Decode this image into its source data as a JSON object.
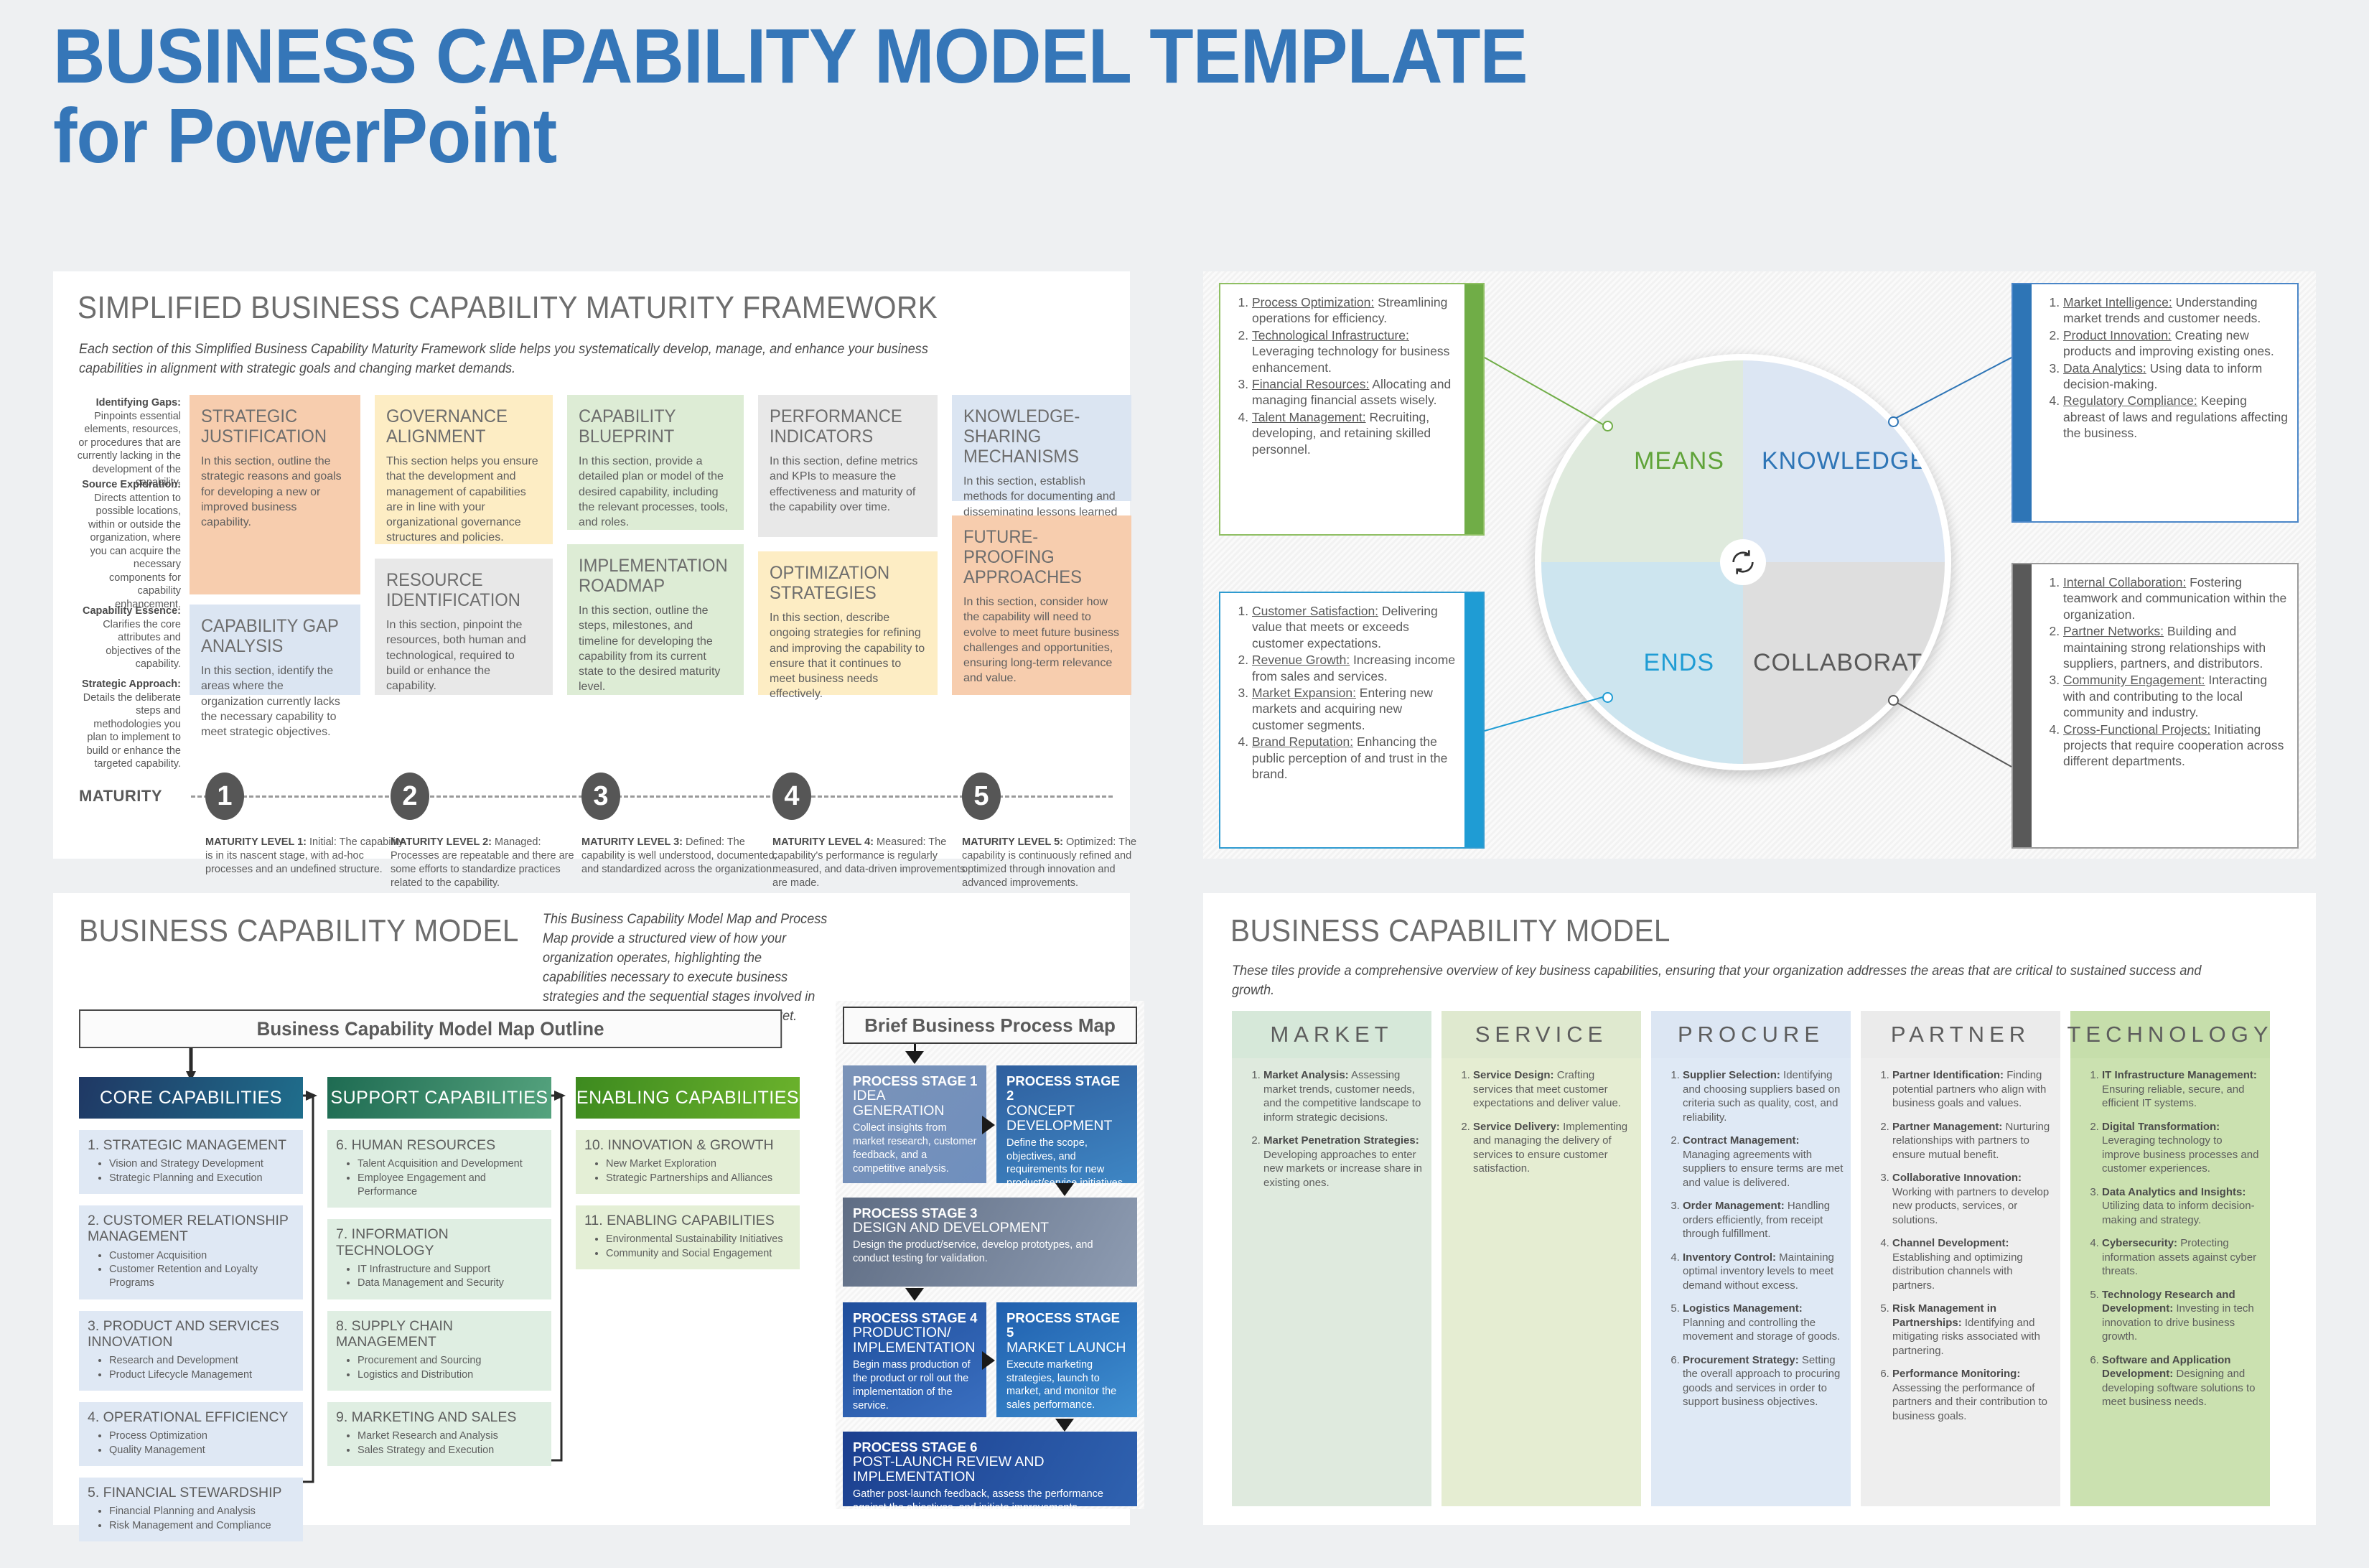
{
  "title": "BUSINESS CAPABILITY MODEL TEMPLATE\nfor PowerPoint",
  "maturity_panel": {
    "title": "SIMPLIFIED BUSINESS CAPABILITY MATURITY FRAMEWORK",
    "intro": "Each section of this Simplified Business Capability Maturity Framework slide helps you systematically develop, manage, and enhance your business capabilities in alignment with strategic goals and changing market demands.",
    "side_notes": [
      {
        "heading": "Identifying Gaps:",
        "body": " Pinpoints essential elements, resources, or procedures that are currently lacking in the development of the capability."
      },
      {
        "heading": "Source Exploration:",
        "body": " Directs attention to possible locations, within or outside the organization, where you can acquire the necessary components for capability enhancement."
      },
      {
        "heading": "Capability Essence:",
        "body": " Clarifies the core attributes and objectives of the capability."
      },
      {
        "heading": "Strategic Approach:",
        "body": " Details the deliberate steps and methodologies you plan to implement to build or enhance the targeted capability."
      }
    ],
    "cards": [
      {
        "heading": "STRATEGIC\nJUSTIFICATION",
        "body": "In this section, outline the strategic reasons and goals for developing a new or improved business capability."
      },
      {
        "heading": "CAPABILITY GAP\nANALYSIS",
        "body": "In this section, identify the areas where the organization currently lacks the necessary capability to meet strategic objectives."
      },
      {
        "heading": "GOVERNANCE\nALIGNMENT",
        "body": "This section helps you ensure that the development and management of capabilities are in line with your organizational governance structures and policies."
      },
      {
        "heading": "RESOURCE\nIDENTIFICATION",
        "body": "In this section, pinpoint the resources, both human and technological, required to build or enhance the capability."
      },
      {
        "heading": "CAPABILITY\nBLUEPRINT",
        "body": "In this section, provide a detailed plan or model of the desired capability, including the relevant processes, tools, and roles."
      },
      {
        "heading": "IMPLEMENTATION\nROADMAP",
        "body": "In this section, outline the steps, milestones, and timeline for developing the capability from its current state to the desired maturity level."
      },
      {
        "heading": "PERFORMANCE\nINDICATORS",
        "body": "In this section, define metrics and KPIs to measure the effectiveness and maturity of the capability over time."
      },
      {
        "heading": "OPTIMIZATION\nSTRATEGIES",
        "body": "In this section, describe ongoing strategies for refining and improving the capability to ensure that it continues to meet business needs effectively."
      },
      {
        "heading": "KNOWLEDGE-SHARING\nMECHANISMS",
        "body": "In this section, establish methods for documenting and disseminating lessons learned and best practices across the organization."
      },
      {
        "heading": "FUTURE-PROOFING\nAPPROACHES",
        "body": "In this section, consider how the capability will need to evolve to meet future business challenges and opportunities, ensuring long-term relevance and value."
      }
    ],
    "axis_label": "MATURITY",
    "levels": [
      {
        "number": "1",
        "heading": "MATURITY LEVEL 1:",
        "body": " Initial: The capability is in its nascent stage, with ad-hoc processes and an undefined structure."
      },
      {
        "number": "2",
        "heading": "MATURITY LEVEL 2:",
        "body": " Managed: Processes are repeatable and there are some efforts to standardize practices related to the capability."
      },
      {
        "number": "3",
        "heading": "MATURITY LEVEL 3:",
        "body": " Defined: The capability is well understood, documented, and standardized across the organization.."
      },
      {
        "number": "4",
        "heading": "MATURITY LEVEL 4:",
        "body": " Measured: The capability's performance is regularly measured, and data-driven improvements are made."
      },
      {
        "number": "5",
        "heading": "MATURITY LEVEL 5:",
        "body": " Optimized: The capability is continuously refined and optimized through innovation and advanced improvements."
      }
    ]
  },
  "quadrant_panel": {
    "quadrants": [
      {
        "label": "MEANS",
        "color": "#70ad47"
      },
      {
        "label": "KNOWLEDGE",
        "color": "#2e75b6"
      },
      {
        "label": "ENDS",
        "color": "#1f9cd4"
      },
      {
        "label": "COLLABORATION",
        "color": "#595959"
      }
    ],
    "hub_icon": "refresh-cycle-icon",
    "means_items": [
      {
        "term": "Process Optimization:",
        "desc": " Streamlining operations for efficiency."
      },
      {
        "term": "Technological Infrastructure:",
        "desc": " Leveraging technology for business enhancement."
      },
      {
        "term": "Financial Resources:",
        "desc": " Allocating and managing financial assets wisely."
      },
      {
        "term": "Talent Management:",
        "desc": " Recruiting, developing, and retaining skilled personnel."
      }
    ],
    "ends_items": [
      {
        "term": "Customer Satisfaction:",
        "desc": " Delivering value that meets or exceeds customer expectations."
      },
      {
        "term": "Revenue Growth:",
        "desc": " Increasing income from sales and services."
      },
      {
        "term": "Market Expansion:",
        "desc": " Entering new markets and acquiring new customer segments."
      },
      {
        "term": "Brand Reputation:",
        "desc": " Enhancing the public perception of and trust in the brand."
      }
    ],
    "knowledge_items": [
      {
        "term": "Market Intelligence:",
        "desc": " Understanding market trends and customer needs."
      },
      {
        "term": "Product Innovation:",
        "desc": " Creating new products and improving existing ones."
      },
      {
        "term": "Data Analytics:",
        "desc": " Using data to inform decision-making."
      },
      {
        "term": "Regulatory Compliance:",
        "desc": " Keeping abreast of laws and regulations affecting the business."
      }
    ],
    "collaboration_items": [
      {
        "term": "Internal Collaboration:",
        "desc": " Fostering teamwork and communication within the organization."
      },
      {
        "term": "Partner Networks:",
        "desc": " Building and maintaining strong relationships with suppliers, partners, and distributors."
      },
      {
        "term": "Community Engagement:",
        "desc": " Interacting with and contributing to the local community and industry."
      },
      {
        "term": "Cross-Functional Projects:",
        "desc": " Initiating projects that require cooperation across different departments."
      }
    ]
  },
  "bcm_map_panel": {
    "title": "BUSINESS CAPABILITY MODEL",
    "intro": "This Business Capability Model Map and Process Map provide a structured view of how your organization operates, highlighting the capabilities necessary to execute business strategies and the sequential stages involved in bringing new products or services to market.",
    "outline_heading": "Business Capability Model Map Outline",
    "columns": [
      {
        "header": "CORE CAPABILITIES",
        "items": [
          {
            "title": "1. STRATEGIC MANAGEMENT",
            "bullets": [
              "Vision and Strategy Development",
              "Strategic Planning and Execution"
            ]
          },
          {
            "title": "2. CUSTOMER RELATIONSHIP MANAGEMENT",
            "bullets": [
              "Customer Acquisition",
              "Customer Retention and Loyalty Programs"
            ]
          },
          {
            "title": "3. PRODUCT AND SERVICES INNOVATION",
            "bullets": [
              "Research and Development",
              "Product Lifecycle Management"
            ]
          },
          {
            "title": "4. OPERATIONAL EFFICIENCY",
            "bullets": [
              "Process Optimization",
              "Quality Management"
            ]
          },
          {
            "title": "5. FINANCIAL STEWARDSHIP",
            "bullets": [
              "Financial Planning and Analysis",
              "Risk Management and Compliance"
            ]
          }
        ]
      },
      {
        "header": "SUPPORT CAPABILITIES",
        "items": [
          {
            "title": "6. HUMAN RESOURCES",
            "bullets": [
              "Talent Acquisition and Development",
              "Employee Engagement and Performance"
            ]
          },
          {
            "title": "7. INFORMATION TECHNOLOGY",
            "bullets": [
              "IT Infrastructure and Support",
              "Data Management and Security"
            ]
          },
          {
            "title": "8. SUPPLY CHAIN MANAGEMENT",
            "bullets": [
              "Procurement and Sourcing",
              "Logistics and Distribution"
            ]
          },
          {
            "title": "9. MARKETING AND SALES",
            "bullets": [
              "Market Research and Analysis",
              "Sales Strategy and Execution"
            ]
          }
        ]
      },
      {
        "header": "ENABLING CAPABILITIES",
        "items": [
          {
            "title": "10. INNOVATION & GROWTH",
            "bullets": [
              "New Market Exploration",
              "Strategic Partnerships and Alliances"
            ]
          },
          {
            "title": "11. ENABLING CAPABILITIES",
            "bullets": [
              "Environmental Sustainability Initiatives",
              "Community and Social Engagement"
            ]
          }
        ]
      }
    ],
    "process_map": {
      "heading": "Brief Business Process Map",
      "stages": [
        {
          "number": "PROCESS STAGE 1",
          "name": "IDEA GENERATION",
          "desc": "Collect insights from market research, customer feedback, and a competitive analysis."
        },
        {
          "number": "PROCESS STAGE 2",
          "name": "CONCEPT\nDEVELOPMENT",
          "desc": "Define the scope, objectives, and requirements for new product/service initiatives."
        },
        {
          "number": "PROCESS STAGE 3",
          "name": "DESIGN AND DEVELOPMENT",
          "desc": "Design the product/service, develop prototypes, and conduct testing for validation."
        },
        {
          "number": "PROCESS STAGE 4",
          "name": "PRODUCTION/\nIMPLEMENTATION",
          "desc": "Begin mass production of the product or roll out the implementation of the service."
        },
        {
          "number": "PROCESS STAGE 5",
          "name": "MARKET LAUNCH",
          "desc": "Execute marketing strategies, launch to market, and monitor the sales performance."
        },
        {
          "number": "PROCESS STAGE 6",
          "name": "POST-LAUNCH REVIEW AND IMPLEMENTATION",
          "desc": "Gather post-launch feedback, assess the performance against the objectives, and initiate improvements."
        }
      ]
    }
  },
  "bcm_tiles_panel": {
    "title": "BUSINESS CAPABILITY MODEL",
    "intro": "These tiles provide a comprehensive overview of key business capabilities, ensuring that your organization addresses the areas that are critical to sustained success and growth.",
    "tiles": [
      {
        "header": "MARKET",
        "items": [
          {
            "term": "Market Analysis:",
            "desc": " Assessing market trends, customer needs, and the competitive landscape to inform strategic decisions."
          },
          {
            "term": "Market Penetration Strategies:",
            "desc": " Developing approaches to enter new markets or increase share in existing ones."
          }
        ]
      },
      {
        "header": "SERVICE",
        "items": [
          {
            "term": "Service Design:",
            "desc": " Crafting services that meet customer expectations and deliver value."
          },
          {
            "term": "Service Delivery:",
            "desc": " Implementing and managing the delivery of services to ensure customer satisfaction."
          }
        ]
      },
      {
        "header": "PROCURE",
        "items": [
          {
            "term": "Supplier Selection:",
            "desc": " Identifying and choosing suppliers based on criteria such as quality, cost, and reliability."
          },
          {
            "term": "Contract Management:",
            "desc": " Managing agreements with suppliers to ensure terms are met and value is delivered."
          },
          {
            "term": "Order Management:",
            "desc": " Handling orders efficiently, from receipt through fulfillment."
          },
          {
            "term": "Inventory Control:",
            "desc": " Maintaining optimal inventory levels to meet demand without excess."
          },
          {
            "term": "Logistics Management:",
            "desc": " Planning and controlling the movement and storage of goods."
          },
          {
            "term": "Procurement Strategy:",
            "desc": " Setting the overall approach to procuring goods and services in order to support business objectives."
          }
        ]
      },
      {
        "header": "PARTNER",
        "items": [
          {
            "term": "Partner Identification:",
            "desc": " Finding potential partners who align with business goals and values."
          },
          {
            "term": "Partner Management:",
            "desc": " Nurturing relationships with partners to ensure mutual benefit."
          },
          {
            "term": "Collaborative Innovation:",
            "desc": " Working with partners to develop new products, services, or solutions."
          },
          {
            "term": "Channel Development:",
            "desc": " Establishing and optimizing distribution channels with partners."
          },
          {
            "term": "Risk Management in Partnerships:",
            "desc": " Identifying and mitigating risks associated with partnering."
          },
          {
            "term": "Performance Monitoring:",
            "desc": " Assessing the performance of partners and their contribution to business goals."
          }
        ]
      },
      {
        "header": "TECHNOLOGY",
        "items": [
          {
            "term": "IT Infrastructure Management:",
            "desc": " Ensuring reliable, secure, and efficient IT systems."
          },
          {
            "term": "Digital Transformation:",
            "desc": " Leveraging technology to improve business processes and customer experiences."
          },
          {
            "term": "Data Analytics and Insights:",
            "desc": " Utilizing data to inform decision-making and strategy."
          },
          {
            "term": "Cybersecurity:",
            "desc": " Protecting information assets against cyber threats."
          },
          {
            "term": "Technology Research and Development:",
            "desc": " Investing in tech innovation to drive business growth."
          },
          {
            "term": "Software and Application Development:",
            "desc": " Designing and developing software solutions to meet business needs."
          }
        ]
      }
    ]
  }
}
